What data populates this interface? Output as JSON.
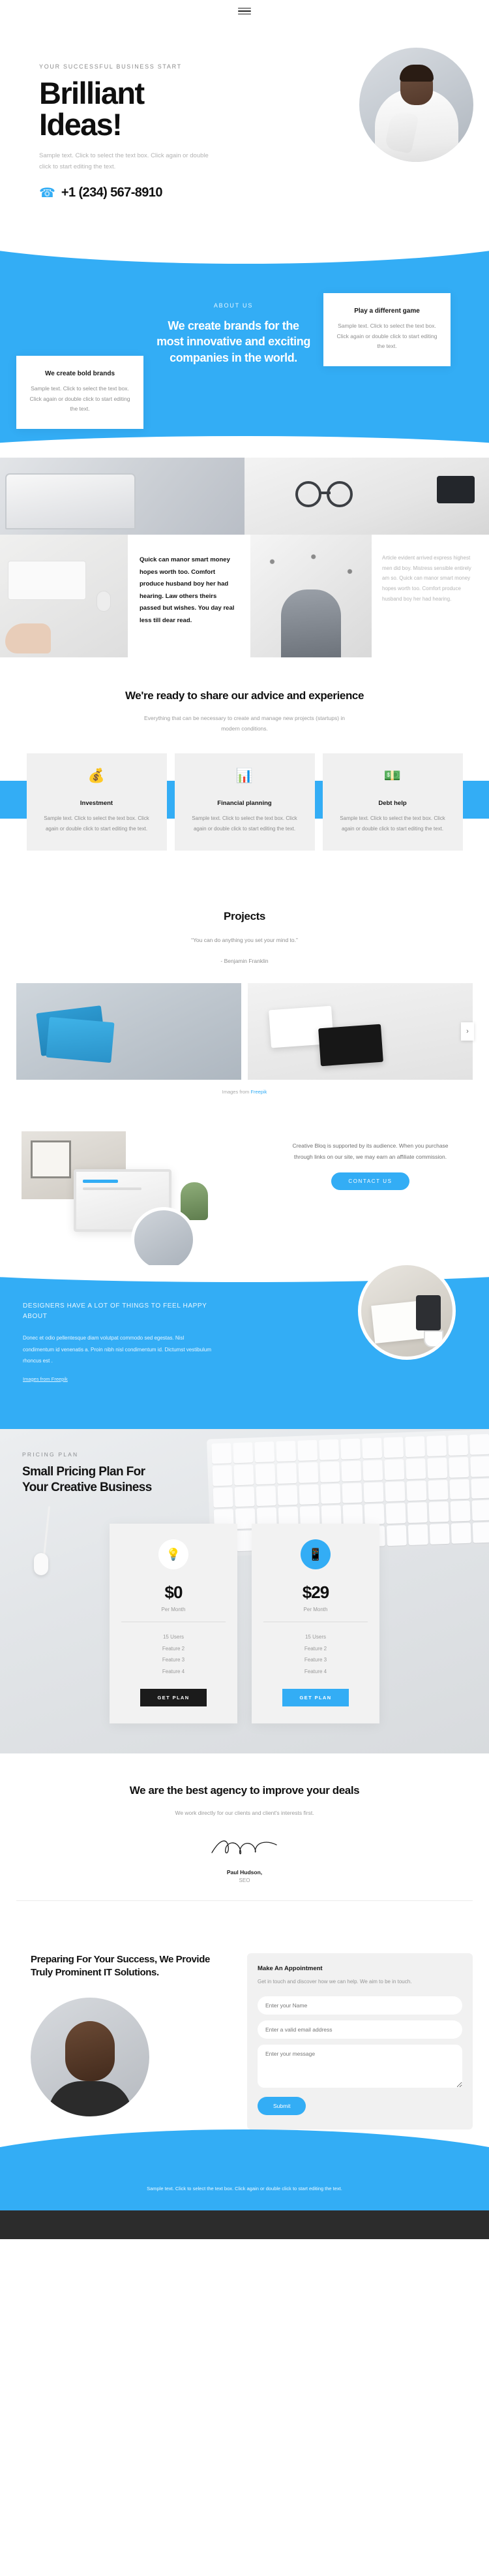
{
  "header": {
    "menu_icon": "hamburger-menu-icon"
  },
  "hero": {
    "eyebrow": "YOUR SUCCESSFUL BUSINESS START",
    "title_line1": "Brilliant",
    "title_line2": "Ideas!",
    "subtitle": "Sample text. Click to select the text box. Click again or double click to start editing the text.",
    "phone_icon": "phone-icon",
    "phone": "+1 (234) 567-8910",
    "accent_color": "#33adf5"
  },
  "about": {
    "eyebrow": "ABOUT US",
    "title": "We create brands for the most innovative and exciting companies in the world.",
    "card_left": {
      "title": "We create bold brands",
      "text": "Sample text. Click to select the text box. Click again or double click to start editing the text."
    },
    "card_right": {
      "title": "Play a different game",
      "text": "Sample text. Click to select the text box. Click again or double click to start editing the text."
    }
  },
  "editorial": {
    "bold_text": "Quick can manor smart money hopes worth too. Comfort produce husband boy her had hearing. Law others theirs passed but wishes. You day real less till dear read.",
    "muted_text": "Article evident arrived express highest men did boy. Mistress sensible entirely am so. Quick can manor smart money hopes worth too. Comfort produce husband boy her had hearing."
  },
  "services": {
    "title": "We're ready to share our advice and experience",
    "subtitle": "Everything that can be necessary to create and manage new projects (startups) in modern conditions.",
    "cards": [
      {
        "icon": "money-coins-icon",
        "glyph": "💰",
        "title": "Investment",
        "text": "Sample text. Click to select the text box. Click again or double click to start editing the text."
      },
      {
        "icon": "finance-chart-icon",
        "glyph": "📊",
        "title": "Financial planning",
        "text": "Sample text. Click to select the text box. Click again or double click to start editing the text."
      },
      {
        "icon": "debt-help-icon",
        "glyph": "💵",
        "title": "Debt help",
        "text": "Sample text. Click to select the text box. Click again or double click to start editing the text."
      }
    ]
  },
  "projects": {
    "title": "Projects",
    "quote": "“You can do anything you set your mind to.”",
    "author": "- Benjamin Franklin",
    "next_icon": "chevron-right-icon",
    "credit_prefix": "Images from ",
    "credit_link": "Freepik"
  },
  "bloq": {
    "text": "Creative Bloq is supported by its audience. When you purchase through links on our site, we may earn an affiliate commission.",
    "button": "CONTACT US"
  },
  "designers": {
    "title": "DESIGNERS HAVE A LOT OF THINGS TO FEEL HAPPY ABOUT",
    "body": "Donec et odio pellentesque diam volutpat commodo sed egestas. Nisl condimentum id venenatis a. Proin nibh nisl condimentum id. Dictumst vestibulum rhoncus est .",
    "credit": "Images from Freepik"
  },
  "pricing": {
    "eyebrow": "PRICING PLAN",
    "title_line1": "Small Pricing Plan For",
    "title_line2": "Your Creative Business",
    "plans": [
      {
        "icon": "lightbulb-icon",
        "glyph": "💡",
        "icon_style": "light",
        "price": "$0",
        "period": "Per Month",
        "features": [
          "15 Users",
          "Feature 2",
          "Feature 3",
          "Feature 4"
        ],
        "button": "GET PLAN",
        "button_style": "dark"
      },
      {
        "icon": "mobile-device-icon",
        "glyph": "📱",
        "icon_style": "blue",
        "price": "$29",
        "period": "Per Month",
        "features": [
          "15 Users",
          "Feature 2",
          "Feature 3",
          "Feature 4"
        ],
        "button": "GET PLAN",
        "button_style": "blue"
      }
    ]
  },
  "agency": {
    "title": "We are the best agency to improve your deals",
    "text": "We work directly for our clients and client's interests first.",
    "signature_icon": "signature-icon",
    "name": "Paul Hudson,",
    "role": "SEO"
  },
  "contact": {
    "title": "Preparing For Your Success, We Provide Truly Prominent IT Solutions.",
    "form": {
      "heading": "Make An Appointment",
      "note": "Get in touch and discover how we can help. We aim to be in touch.",
      "name_placeholder": "Enter your Name",
      "email_placeholder": "Enter a valid email address",
      "message_placeholder": "Enter your message",
      "submit": "Submit"
    }
  },
  "footer": {
    "text": "Sample text. Click to select the text box. Click again or double click to start editing the text."
  }
}
